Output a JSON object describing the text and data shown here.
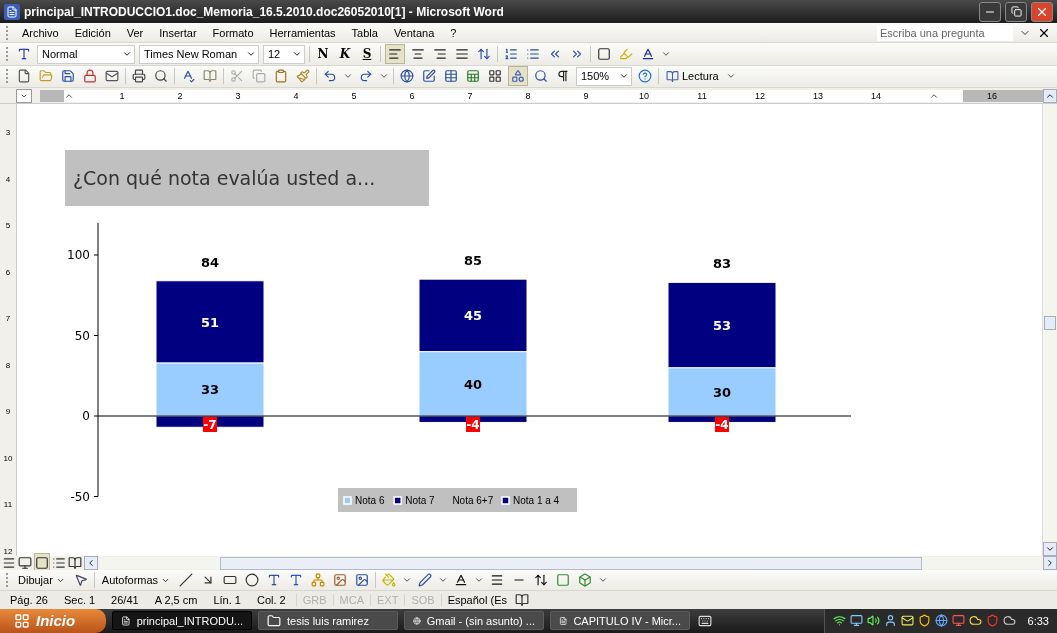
{
  "window": {
    "title": "principal_INTRODUCCIO1.doc_Memoria_16.5.2010.doc26052010[1] - Microsoft Word"
  },
  "menu": [
    "Archivo",
    "Edición",
    "Ver",
    "Insertar",
    "Formato",
    "Herramientas",
    "Tabla",
    "Ventana",
    "?"
  ],
  "help_box": {
    "placeholder": "Escriba una pregunta"
  },
  "formatting_toolbar": {
    "style": "Normal",
    "font": "Times New Roman",
    "size": "12",
    "bold": "N",
    "italic": "K",
    "underline": "S"
  },
  "standard_toolbar": {
    "zoom": "150%",
    "reading_button": "Lectura"
  },
  "ruler": {
    "numbers": [
      "1",
      "2",
      "3",
      "4",
      "5",
      "6",
      "7",
      "8",
      "9",
      "10",
      "11",
      "12",
      "13",
      "14",
      "16"
    ]
  },
  "vertical_ruler": {
    "numbers": [
      "3",
      "4",
      "5",
      "6",
      "7",
      "8",
      "9",
      "10",
      "11",
      "12"
    ]
  },
  "document": {
    "chart_title": "¿Con qué nota evalúa usted a...",
    "totals_legend_label": "Nota 6+7",
    "chart_data": {
      "type": "bar",
      "stacked": true,
      "ylim": [
        -50,
        120
      ],
      "yticks": [
        -50,
        0,
        50,
        100
      ],
      "data_labels": true,
      "series": [
        {
          "name": "Nota 6",
          "color": "#99ccff",
          "values": [
            33,
            40,
            30
          ]
        },
        {
          "name": "Nota 7",
          "color": "#000080",
          "values": [
            51,
            45,
            53
          ]
        },
        {
          "name": "Nota 1 a 4",
          "color": "#000080",
          "values": [
            -7,
            -4,
            -4
          ]
        }
      ],
      "legend": "bottom",
      "annotations": [
        {
          "y": 84,
          "text": "84"
        },
        {
          "y": 85,
          "text": "85"
        },
        {
          "y": 83,
          "text": "83"
        }
      ]
    }
  },
  "drawing_toolbar": {
    "draw_menu": "Dibujar",
    "autoshapes_menu": "Autoformas"
  },
  "status_bar": {
    "fields": [
      "Pág. 26",
      "Sec. 1",
      "26/41",
      "A 2,5 cm",
      "Lín. 1",
      "Col. 2"
    ],
    "modes": [
      {
        "label": "GRB",
        "on": false
      },
      {
        "label": "MCA",
        "on": false
      },
      {
        "label": "EXT",
        "on": false
      },
      {
        "label": "SOB",
        "on": false
      }
    ],
    "language": "Español (Es"
  },
  "taskbar": {
    "start": "Inicio",
    "tasks": [
      {
        "label": "principal_INTRODU...",
        "selected": true
      },
      {
        "label": "tesis luis ramirez",
        "selected": false
      },
      {
        "label": "Gmail - (sin asunto) ...",
        "selected": false
      },
      {
        "label": "CAPITULO IV - Micr...",
        "selected": false
      }
    ],
    "clock": "6:33"
  }
}
